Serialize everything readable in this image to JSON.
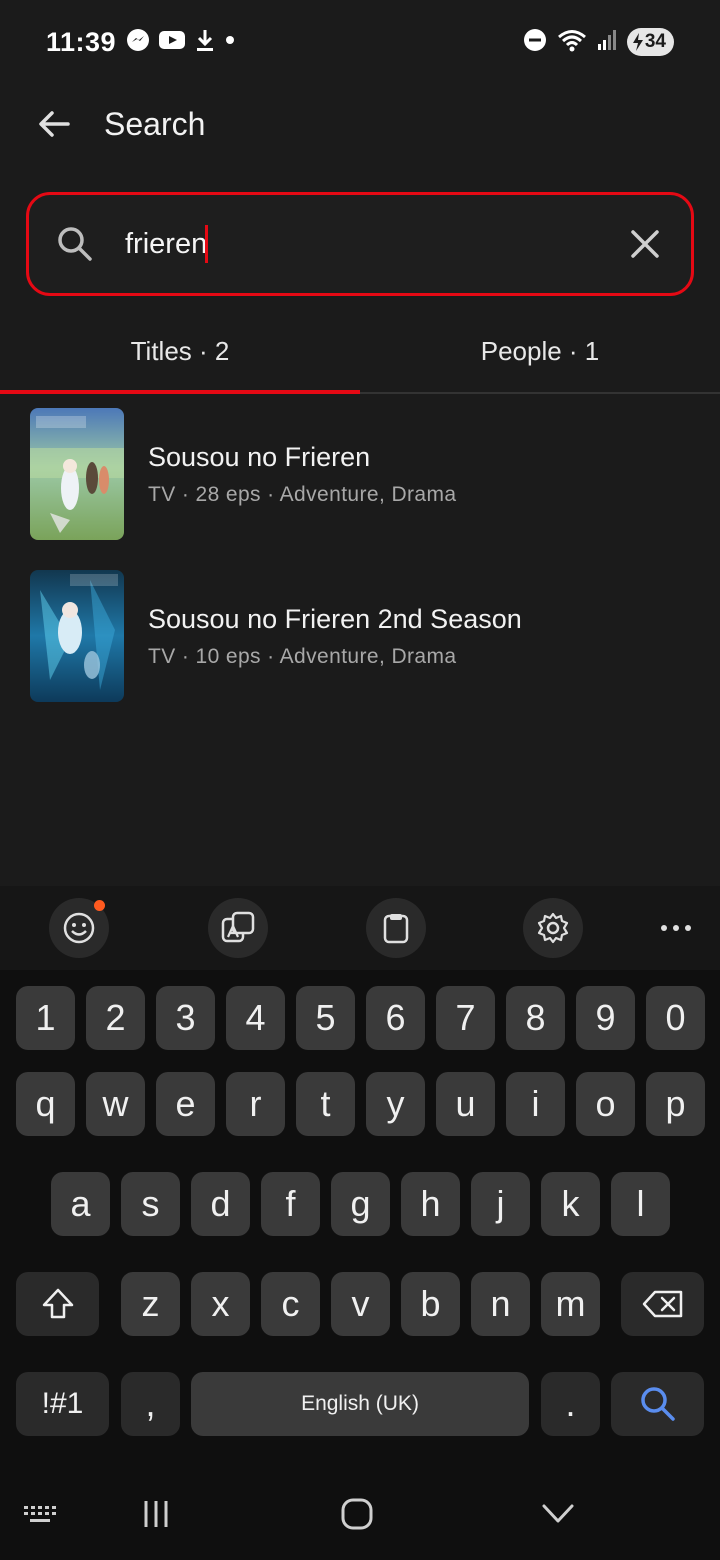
{
  "status_bar": {
    "time": "11:39",
    "battery": "34",
    "icons": [
      "messenger-icon",
      "youtube-icon",
      "download-icon",
      "dot-icon",
      "dnd-icon",
      "wifi-icon",
      "signal-icon",
      "battery-icon"
    ]
  },
  "header": {
    "title": "Search",
    "back_icon": "arrow-left-icon"
  },
  "search": {
    "value": "frieren",
    "search_icon": "search-icon",
    "clear_icon": "close-icon"
  },
  "tabs": [
    {
      "label": "Titles · 2",
      "active": true
    },
    {
      "label": "People · 1",
      "active": false
    }
  ],
  "results": [
    {
      "title": "Sousou no Frieren",
      "meta": "TV · 28 eps · Adventure, Drama"
    },
    {
      "title": "Sousou no Frieren 2nd Season",
      "meta": "TV · 10 eps · Adventure, Drama"
    }
  ],
  "keyboard": {
    "toolbar": [
      "emoji-icon",
      "translate-icon",
      "clipboard-icon",
      "settings-icon",
      "more-icon"
    ],
    "row_numbers": [
      "1",
      "2",
      "3",
      "4",
      "5",
      "6",
      "7",
      "8",
      "9",
      "0"
    ],
    "row_1": [
      "q",
      "w",
      "e",
      "r",
      "t",
      "y",
      "u",
      "i",
      "o",
      "p"
    ],
    "row_2": [
      "a",
      "s",
      "d",
      "f",
      "g",
      "h",
      "j",
      "k",
      "l"
    ],
    "row_3": [
      "z",
      "x",
      "c",
      "v",
      "b",
      "n",
      "m"
    ],
    "symbols_label": "!#1",
    "comma": ",",
    "space_label": "English (UK)",
    "period": ".",
    "accent_color": "#5a8dee"
  },
  "nav": [
    "keyboard-hide-icon",
    "recents-icon",
    "home-icon",
    "back-icon"
  ]
}
